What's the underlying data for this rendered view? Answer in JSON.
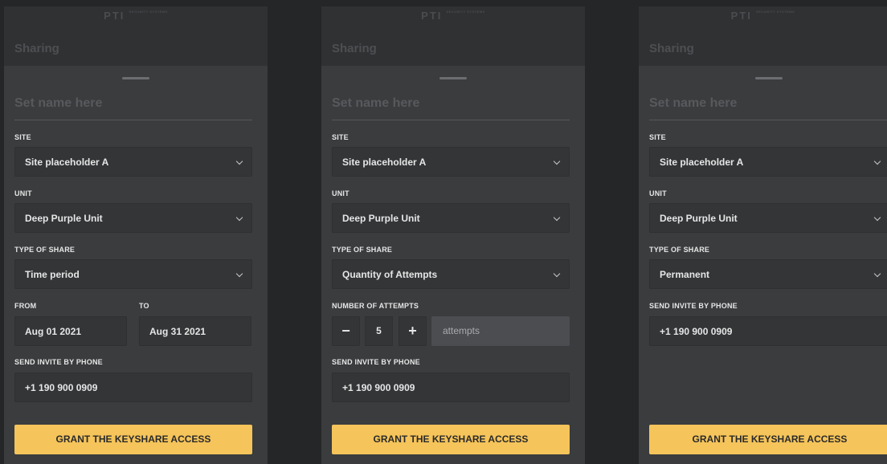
{
  "brand": {
    "logo": "PTI",
    "logo_sub": "SECURITY SYSTEMS"
  },
  "header": {
    "title": "Sharing"
  },
  "form": {
    "name_placeholder": "Set name here",
    "site_label": "SITE",
    "site_value": "Site placeholder A",
    "unit_label": "UNIT",
    "unit_value": "Deep Purple Unit",
    "type_label": "TYPE OF SHARE",
    "phone_label": "SEND INVITE BY PHONE",
    "phone_value": "+1 190 900 0909",
    "grant_label": "GRANT THE KEYSHARE ACCESS"
  },
  "screens": [
    {
      "type_value": "Time period",
      "from_label": "FROM",
      "to_label": "TO",
      "from_value": "Aug 01 2021",
      "to_value": "Aug 31 2021"
    },
    {
      "type_value": "Quantity of Attempts",
      "attempts_label": "NUMBER OF ATTEMPTS",
      "minus": "−",
      "plus": "+",
      "attempts_value": "5",
      "attempts_unit": "attempts"
    },
    {
      "type_value": "Permanent"
    }
  ]
}
